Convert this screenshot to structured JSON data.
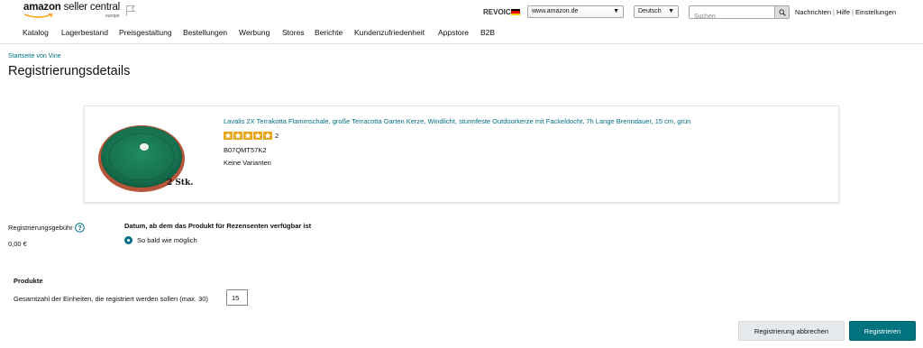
{
  "header": {
    "logo_brand": "amazon",
    "logo_product": "seller central",
    "logo_region": "europe",
    "account_name": "REVOIC",
    "marketplace": "www.amazon.de",
    "language": "Deutsch",
    "search_placeholder": "Suchen",
    "links": [
      "Nachrichten",
      "Hilfe",
      "Einstellungen"
    ]
  },
  "nav": {
    "items": [
      "Katalog",
      "Lagerbestand",
      "Preisgestaltung",
      "Bestellungen",
      "Werbung",
      "Stores",
      "Berichte",
      "Kundenzufriedenheit",
      "Appstore",
      "B2B"
    ]
  },
  "breadcrumb": "Startseite von Vine",
  "page_title": "Registrierungsdetails",
  "product": {
    "title": "Lavalis 2X Terrakotta Flammschale, große Terracotta Garten Kerze, Windlicht, sturmfeste Outdoorkerze mit Fackeldocht, 7h Lange Brenndauer, 15 cm, grün",
    "rating_stars": 5,
    "rating_count": "2",
    "asin": "B07QMT57K2",
    "variants": "Keine Varianten",
    "image_caption": "2 Stk."
  },
  "fee": {
    "label": "Registrierungsgebühr",
    "value": "0,00 €"
  },
  "availability": {
    "heading": "Datum, ab dem das Produkt für Rezensenten verfügbar ist",
    "option_label": "So bald wie möglich"
  },
  "products_section": {
    "heading": "Produkte",
    "units_label": "Gesamtzahl der Einheiten, die registriert werden sollen (max. 30)",
    "units_value": "15"
  },
  "buttons": {
    "cancel": "Registrierung abbrechen",
    "register": "Registrieren"
  },
  "colors": {
    "accent": "#00737f",
    "link": "#007185",
    "star": "#f4a21c"
  }
}
